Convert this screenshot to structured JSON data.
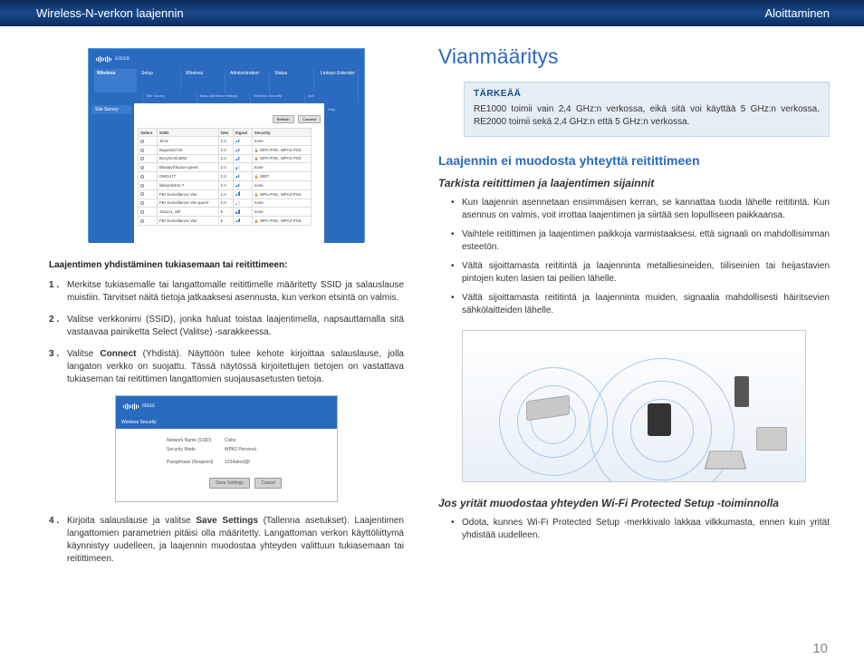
{
  "header": {
    "left": "Wireless-N-verkon laajennin",
    "right": "Aloittaminen"
  },
  "page_number": "10",
  "screenshot1": {
    "brand_label": "Linksys Extender",
    "left_tab": "Wireless",
    "top_tabs": [
      "Setup",
      "Wireless",
      "Administration",
      "Status"
    ],
    "sub_tabs": [
      "Site Survey",
      "Basic Wireless Settings",
      "Wireless Security",
      "QoS"
    ],
    "side_button": "Site Survey",
    "btn_refresh": "Refresh",
    "btn_connect": "Connect",
    "right_pane_label": "Help...",
    "columns": [
      "Select",
      "SSID",
      "GHz",
      "Signal",
      "Security"
    ],
    "rows": [
      {
        "ssid": "JimS",
        "ghz": "2.4",
        "sig": 3,
        "sec": "none"
      },
      {
        "ssid": "twguest2720",
        "ghz": "2.4",
        "sig": 3,
        "sec": "WPA-PSK, WPA2-PSK"
      },
      {
        "ssid": "BusyOcelot262",
        "ghz": "2.4",
        "sig": 3,
        "sec": "WPA-PSK, WPA2-PSK"
      },
      {
        "ssid": "BluejayStripion-guest",
        "ghz": "2.4",
        "sig": 2,
        "sec": "none"
      },
      {
        "ssid": "OMG477",
        "ghz": "2.4",
        "sig": 3,
        "sec": "WEP"
      },
      {
        "ssid": "linksys5341-7",
        "ghz": "2.4",
        "sig": 3,
        "sec": "none"
      },
      {
        "ssid": "FBI Surveillance Van",
        "ghz": "2.4",
        "sig": 4,
        "sec": "WPA-PSK, WPA2-PSK"
      },
      {
        "ssid": "FBI Surveillance Van-guest",
        "ghz": "2.4",
        "sig": 1,
        "sec": "none"
      },
      {
        "ssid": "Jason1_wifi",
        "ghz": "5",
        "sig": 4,
        "sec": "none"
      },
      {
        "ssid": "FBI Surveillance Van",
        "ghz": "5",
        "sig": 4,
        "sec": "WPA-PSK, WPA2-PSK"
      }
    ]
  },
  "caption1": "Laajentimen yhdistäminen tukiasemaan tai reitittimeen:",
  "steps": [
    {
      "num": "1 .",
      "html": "Merkitse tukiasemalle tai langattomalle reitittimelle määritetty SSID ja salauslause muistiin. Tarvitset näitä tietoja jatkaaksesi asennusta, kun verkon etsintä on valmis."
    },
    {
      "num": "2 .",
      "html": "Valitse verkkonimi (SSID), jonka haluat toistaa laajentimella, napsauttamalla sitä vastaavaa painiketta Select (Valitse) -sarakkeessa."
    },
    {
      "num": "3 .",
      "html": "Valitse <strong>Connect</strong> (Yhdistä). Näyttöön tulee kehote kirjoittaa salauslause, jolla langaton verkko on suojattu. Tässä näytössä kirjoitettujen tietojen on vastattava tukiaseman tai reitittimen langattomien suojausasetusten tietoja."
    },
    {
      "num": "4 .",
      "html": "Kirjoita salauslause ja valitse <strong>Save Settings</strong> (Tallenna asetukset). Laajentimen langattomien parametrien pitäisi olla määritetty. Langattoman verkon käyttöliittymä käynnistyy uudelleen, ja laajennin muodostaa yhteyden valittuun tukiasemaan tai reitittimeen."
    }
  ],
  "screenshot2": {
    "tab_label": "Wireless Security",
    "row1_lbl": "Network Name (SSID)",
    "row1_val": "Cisko",
    "row2_lbl": "Security Mode",
    "row2_val": "WPA2 Personal",
    "row3_lbl": "Passphrase (Required)",
    "row3_val": "1234abcd@!",
    "btn_save": "Save Settings",
    "btn_cancel": "Cancel"
  },
  "right": {
    "h1": "Vianmääritys",
    "note_title": "TÄRKEÄÄ",
    "note_body": "RE1000 toimii vain 2,4 GHz:n verkossa, eikä sitä voi käyttää 5 GHz:n verkossa. RE2000 toimii sekä 2,4 GHz:n että 5 GHz:n verkossa.",
    "h2": "Laajennin ei muodosta yhteyttä reitittimeen",
    "h3a": "Tarkista reitittimen ja laajentimen sijainnit",
    "bullets_a": [
      "Kun laajennin asennetaan ensimmäisen kerran, se kannattaa tuoda lähelle reititintä. Kun asennus on valmis, voit irrottaa laajentimen ja siirtää sen lopulliseen paikkaansa.",
      "Vaihtele reitittimen ja laajentimen paikkoja varmistaaksesi, että signaali on mahdollisimman esteetön.",
      "Vältä sijoittamasta reititintä ja laajenninta metalliesineiden, tiiliseinien tai heijastavien pintojen kuten lasien tai peilien lähelle.",
      "Vältä sijoittamasta reititintä ja laajenninta muiden, signaalia mahdollisesti häiritsevien sähkölaitteiden lähelle."
    ],
    "h3b": "Jos yrität muodostaa yhteyden Wi-Fi Protected Setup -toiminnolla",
    "bullets_b": [
      "Odota, kunnes Wi-Fi Protected Setup -merkkivalo lakkaa vilkkumasta, ennen kuin yrität yhdistää uudelleen."
    ]
  }
}
